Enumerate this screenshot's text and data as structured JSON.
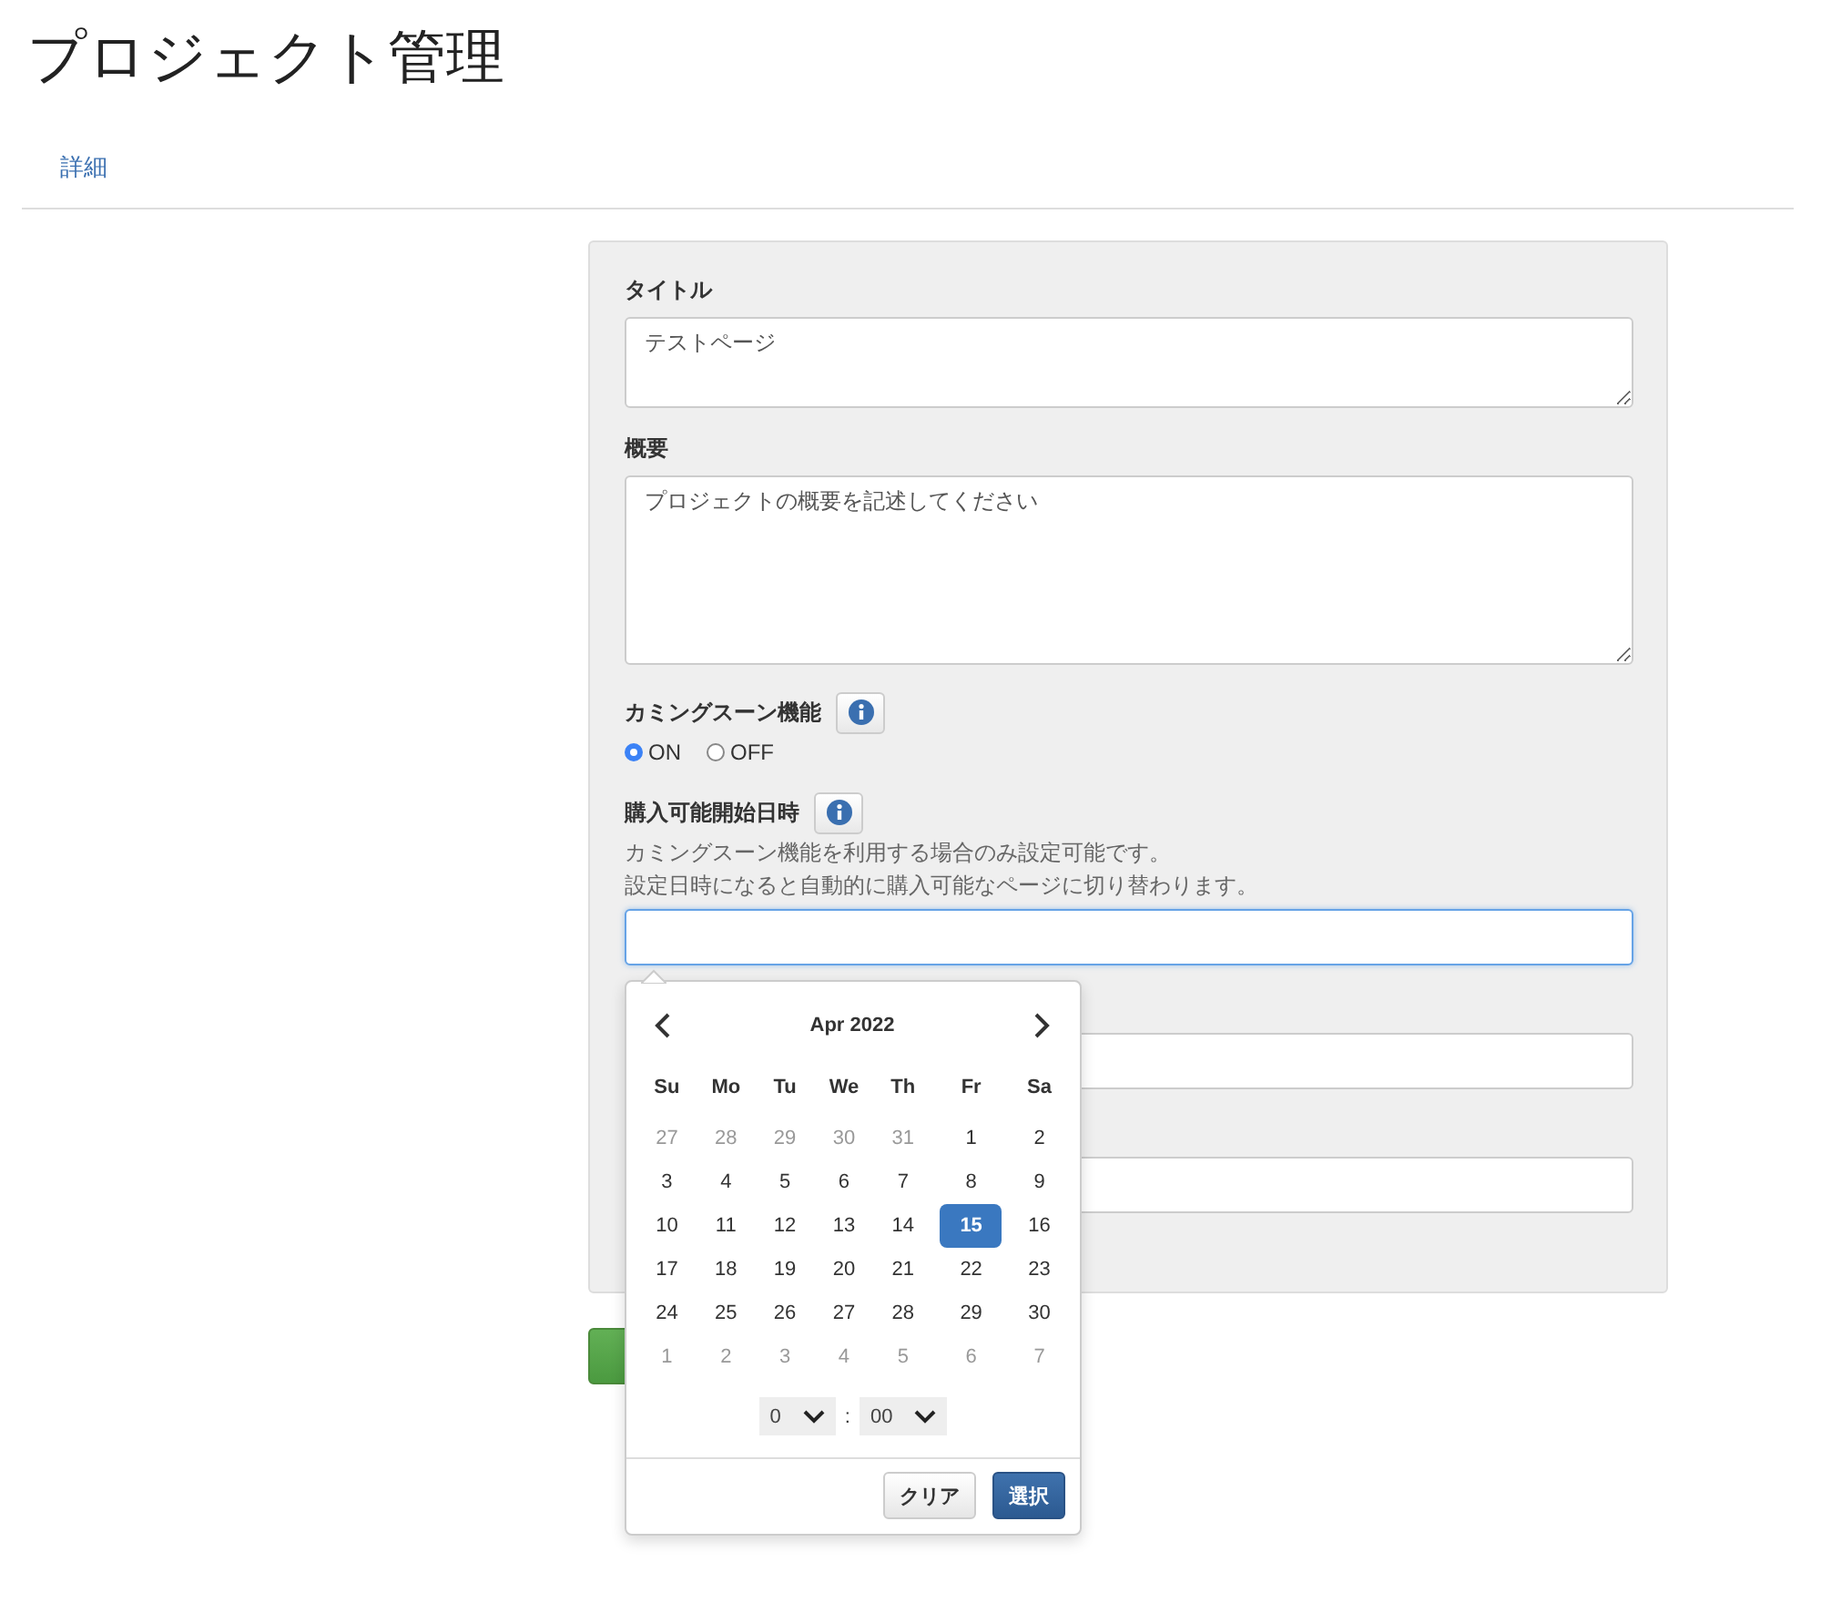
{
  "page": {
    "title": "プロジェクト管理"
  },
  "nav_links": [
    {
      "label": "詳細"
    }
  ],
  "form": {
    "title_field": {
      "label": "タイトル",
      "value": "テストページ"
    },
    "summary_field": {
      "label": "概要",
      "value": "プロジェクトの概要を記述してください"
    },
    "coming_soon": {
      "label": "カミングスーン機能",
      "options": [
        {
          "label": "ON",
          "selected": true
        },
        {
          "label": "OFF",
          "selected": false
        }
      ]
    },
    "purchase_start": {
      "label": "購入可能開始日時",
      "help": [
        "カミングスーン機能を利用する場合のみ設定可能です。",
        "設定日時になると自動的に購入可能なページに切り替わります。"
      ],
      "focused": true
    },
    "hidden_fields": [
      {
        "kind": "input"
      },
      {
        "kind": "input"
      }
    ]
  },
  "submit_button": {
    "kind": "success"
  },
  "datepicker": {
    "month": "Apr 2022",
    "weekdays": [
      "Su",
      "Mo",
      "Tu",
      "We",
      "Th",
      "Fr",
      "Sa"
    ],
    "weeks": [
      [
        {
          "day": "27",
          "kind": "other",
          "selected": false
        },
        {
          "day": "28",
          "kind": "other",
          "selected": false
        },
        {
          "day": "29",
          "kind": "other",
          "selected": false
        },
        {
          "day": "30",
          "kind": "other",
          "selected": false
        },
        {
          "day": "31",
          "kind": "other",
          "selected": false
        },
        {
          "day": "1",
          "kind": "current",
          "selected": false
        },
        {
          "day": "2",
          "kind": "current",
          "selected": false
        }
      ],
      [
        {
          "day": "3",
          "kind": "current",
          "selected": false
        },
        {
          "day": "4",
          "kind": "current",
          "selected": false
        },
        {
          "day": "5",
          "kind": "current",
          "selected": false
        },
        {
          "day": "6",
          "kind": "current",
          "selected": false
        },
        {
          "day": "7",
          "kind": "current",
          "selected": false
        },
        {
          "day": "8",
          "kind": "current",
          "selected": false
        },
        {
          "day": "9",
          "kind": "current",
          "selected": false
        }
      ],
      [
        {
          "day": "10",
          "kind": "current",
          "selected": false
        },
        {
          "day": "11",
          "kind": "current",
          "selected": false
        },
        {
          "day": "12",
          "kind": "current",
          "selected": false
        },
        {
          "day": "13",
          "kind": "current",
          "selected": false
        },
        {
          "day": "14",
          "kind": "current",
          "selected": false
        },
        {
          "day": "15",
          "kind": "current",
          "selected": true
        },
        {
          "day": "16",
          "kind": "current",
          "selected": false
        }
      ],
      [
        {
          "day": "17",
          "kind": "current",
          "selected": false
        },
        {
          "day": "18",
          "kind": "current",
          "selected": false
        },
        {
          "day": "19",
          "kind": "current",
          "selected": false
        },
        {
          "day": "20",
          "kind": "current",
          "selected": false
        },
        {
          "day": "21",
          "kind": "current",
          "selected": false
        },
        {
          "day": "22",
          "kind": "current",
          "selected": false
        },
        {
          "day": "23",
          "kind": "current",
          "selected": false
        }
      ],
      [
        {
          "day": "24",
          "kind": "current",
          "selected": false
        },
        {
          "day": "25",
          "kind": "current",
          "selected": false
        },
        {
          "day": "26",
          "kind": "current",
          "selected": false
        },
        {
          "day": "27",
          "kind": "current",
          "selected": false
        },
        {
          "day": "28",
          "kind": "current",
          "selected": false
        },
        {
          "day": "29",
          "kind": "current",
          "selected": false
        },
        {
          "day": "30",
          "kind": "current",
          "selected": false
        }
      ],
      [
        {
          "day": "1",
          "kind": "other",
          "selected": false
        },
        {
          "day": "2",
          "kind": "other",
          "selected": false
        },
        {
          "day": "3",
          "kind": "other",
          "selected": false
        },
        {
          "day": "4",
          "kind": "other",
          "selected": false
        },
        {
          "day": "5",
          "kind": "other",
          "selected": false
        },
        {
          "day": "6",
          "kind": "other",
          "selected": false
        },
        {
          "day": "7",
          "kind": "other",
          "selected": false
        }
      ]
    ],
    "hour": "0",
    "separator": ":",
    "minute": "00",
    "buttons": [
      {
        "label": "クリア",
        "kind": "default"
      },
      {
        "label": "選択",
        "kind": "primary"
      }
    ]
  }
}
